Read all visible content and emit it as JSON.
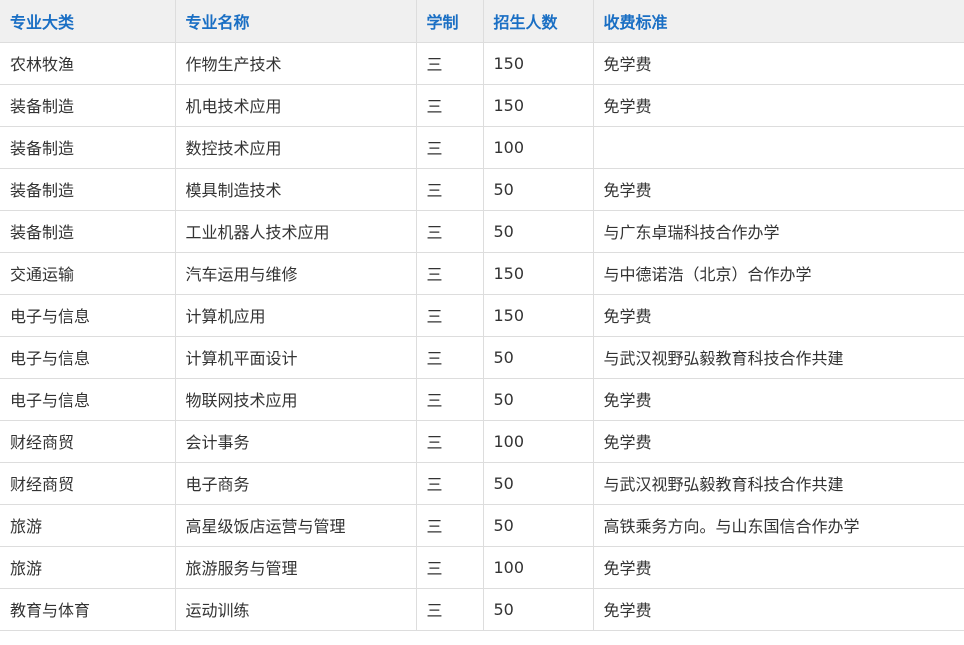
{
  "table": {
    "headers": [
      "专业大类",
      "专业名称",
      "学制",
      "招生人数",
      "收费标准"
    ],
    "rows": [
      [
        "农林牧渔",
        "作物生产技术",
        "三",
        "150",
        "免学费"
      ],
      [
        "装备制造",
        "机电技术应用",
        "三",
        "150",
        "免学费"
      ],
      [
        "装备制造",
        "数控技术应用",
        "三",
        "100",
        ""
      ],
      [
        "装备制造",
        "模具制造技术",
        "三",
        "50",
        "免学费"
      ],
      [
        "装备制造",
        "工业机器人技术应用",
        "三",
        "50",
        "与广东卓瑞科技合作办学"
      ],
      [
        "交通运输",
        "汽车运用与维修",
        "三",
        "150",
        "与中德诺浩（北京）合作办学"
      ],
      [
        "电子与信息",
        "计算机应用",
        "三",
        "150",
        "免学费"
      ],
      [
        "电子与信息",
        "计算机平面设计",
        "三",
        "50",
        "与武汉视野弘毅教育科技合作共建"
      ],
      [
        "电子与信息",
        "物联网技术应用",
        "三",
        "50",
        "免学费"
      ],
      [
        "财经商贸",
        "会计事务",
        "三",
        "100",
        "免学费"
      ],
      [
        "财经商贸",
        "电子商务",
        "三",
        "50",
        "与武汉视野弘毅教育科技合作共建"
      ],
      [
        "旅游",
        "高星级饭店运营与管理",
        "三",
        "50",
        "高铁乘务方向。与山东国信合作办学"
      ],
      [
        "旅游",
        "旅游服务与管理",
        "三",
        "100",
        "免学费"
      ],
      [
        "教育与体育",
        "运动训练",
        "三",
        "50",
        "免学费"
      ]
    ]
  }
}
